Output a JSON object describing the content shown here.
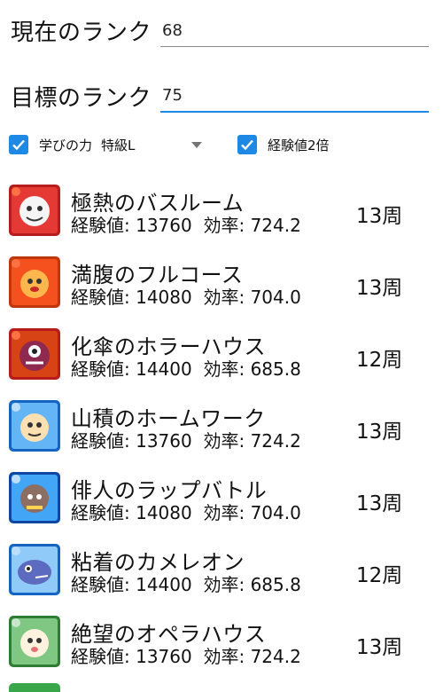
{
  "current_rank": {
    "label": "現在のランク",
    "value": "68"
  },
  "target_rank": {
    "label": "目標のランク",
    "value": "75"
  },
  "options": {
    "learning_power": {
      "label": "学びの力",
      "selected": "特級L",
      "checked": true
    },
    "exp_double": {
      "label": "経験値2倍",
      "checked": true
    }
  },
  "colors": {
    "accent": "#1e88e5"
  },
  "stages": [
    {
      "name": "極熱のバスルーム",
      "exp_label": "経験値:",
      "exp": "13760",
      "eff_label": "効率:",
      "eff": "724.2",
      "laps": "13周",
      "icon": "fire-monster-icon"
    },
    {
      "name": "満腹のフルコース",
      "exp_label": "経験値:",
      "exp": "14080",
      "eff_label": "効率:",
      "eff": "704.0",
      "laps": "13周",
      "icon": "fire-monster-icon"
    },
    {
      "name": "化傘のホラーハウス",
      "exp_label": "経験値:",
      "exp": "14400",
      "eff_label": "効率:",
      "eff": "685.8",
      "laps": "12周",
      "icon": "fire-monster-icon"
    },
    {
      "name": "山積のホームワーク",
      "exp_label": "経験値:",
      "exp": "13760",
      "eff_label": "効率:",
      "eff": "724.2",
      "laps": "13周",
      "icon": "water-monster-icon"
    },
    {
      "name": "俳人のラップバトル",
      "exp_label": "経験値:",
      "exp": "14080",
      "eff_label": "効率:",
      "eff": "704.0",
      "laps": "13周",
      "icon": "water-monster-icon"
    },
    {
      "name": "粘着のカメレオン",
      "exp_label": "経験値:",
      "exp": "14400",
      "eff_label": "効率:",
      "eff": "685.8",
      "laps": "12周",
      "icon": "water-monster-icon"
    },
    {
      "name": "絶望のオペラハウス",
      "exp_label": "経験値:",
      "exp": "13760",
      "eff_label": "効率:",
      "eff": "724.2",
      "laps": "13周",
      "icon": "wood-monster-icon"
    }
  ]
}
